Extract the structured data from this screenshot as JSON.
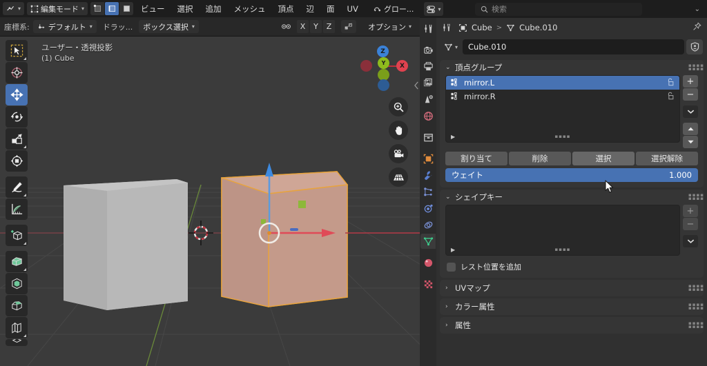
{
  "viewport_header": {
    "editor_type_icon": "editor-type-icon",
    "mode": "編集モード",
    "select_modes": [
      "vertex-select-icon",
      "edge-select-icon",
      "face-select-icon"
    ],
    "active_select_mode_index": 1,
    "menus": [
      "ビュー",
      "選択",
      "追加",
      "メッシュ",
      "頂点",
      "辺",
      "面",
      "UV"
    ],
    "orientation_icon": "global-orientation-icon",
    "orientation": "グロー...",
    "row2": {
      "transform_label": "座標系:",
      "transform_value": "デフォルト",
      "snap_label": "ドラッ...",
      "select_mode": "ボックス選択",
      "proportional_icon": "proportional-editing-icon",
      "axis_toggles": [
        "X",
        "Y",
        "Z"
      ],
      "mirror_icon": "mirror-icon",
      "options": "オプション"
    }
  },
  "viewport": {
    "overlay_line1": "ユーザー・透視投影",
    "overlay_line2": "(1) Cube",
    "gizmo_axes": [
      {
        "label": "Z",
        "color": "#3b82d8"
      },
      {
        "label": "Y",
        "color": "#8ebb1d"
      },
      {
        "label": "X",
        "color": "#e0424f"
      }
    ],
    "nav_buttons": [
      "zoom-icon",
      "pan-hand-icon",
      "camera-icon",
      "orthographic-grid-icon"
    ],
    "toolbar_items": [
      "tweak-select-box-icon",
      "cursor-icon",
      "move-icon",
      "rotate-icon",
      "scale-icon",
      "transform-icon",
      "annotate-icon",
      "measure-icon",
      "add-cube-icon",
      "extrude-region-icon",
      "inset-faces-icon",
      "bevel-icon",
      "loop-cut-icon",
      "knife-icon"
    ],
    "active_tool_index": 2,
    "objects": [
      {
        "name": "cube-unselected",
        "selected": false
      },
      {
        "name": "cube-selected",
        "selected": true
      }
    ],
    "collapse_arrow": "sidebar-collapse-arrow-icon"
  },
  "properties": {
    "header": {
      "editor_type_icon": "properties-editor-icon",
      "search_placeholder": "検索",
      "dropdown_icon": "chevron-down-icon"
    },
    "tabs": [
      {
        "name": "tool",
        "icon": "tool-icon",
        "color": "#b8b8b8",
        "selected": false
      },
      {
        "name": "render",
        "icon": "render-camera-icon",
        "color": "#c8c8c8",
        "selected": false
      },
      {
        "name": "output",
        "icon": "output-printer-icon",
        "color": "#c8c8c8",
        "selected": false
      },
      {
        "name": "view-layer",
        "icon": "view-layer-images-icon",
        "color": "#c8c8c8",
        "selected": false
      },
      {
        "name": "scene",
        "icon": "scene-cone-icon",
        "color": "#c8c8c8",
        "selected": false
      },
      {
        "name": "world",
        "icon": "world-globe-icon",
        "color": "#d06a7a",
        "selected": false
      },
      {
        "name": "collection",
        "icon": "collection-box-icon",
        "color": "#c8c8c8",
        "selected": false
      },
      {
        "name": "object",
        "icon": "object-square-icon",
        "color": "#e08b3c",
        "selected": false
      },
      {
        "name": "modifiers",
        "icon": "wrench-icon",
        "color": "#5a7fd0",
        "selected": false
      },
      {
        "name": "particles",
        "icon": "particles-icon",
        "color": "#7b92d8",
        "selected": false
      },
      {
        "name": "physics",
        "icon": "physics-orbit-icon",
        "color": "#6f8ddb",
        "selected": false
      },
      {
        "name": "constraints",
        "icon": "constraints-icon",
        "color": "#7b92d8",
        "selected": false
      },
      {
        "name": "object-data",
        "icon": "mesh-data-triangle-icon",
        "color": "#3ec98b",
        "selected": true
      },
      {
        "name": "material",
        "icon": "material-sphere-icon",
        "color": "#d4566a",
        "selected": false
      },
      {
        "name": "texture",
        "icon": "texture-checker-icon",
        "color": "#d4566a",
        "selected": false
      }
    ],
    "breadcrumb": {
      "tool_icon": "properties-tool-icon",
      "items": [
        "Cube",
        "Cube.010"
      ],
      "separator": ">",
      "object_icon": "object-square-icon",
      "data_icon": "mesh-data-triangle-icon",
      "pin_icon": "pin-icon"
    },
    "id_block": {
      "icon": "mesh-data-triangle-icon",
      "name": "Cube.010",
      "shield_icon": "fake-user-shield-icon"
    },
    "panels": [
      {
        "id": "vertex_groups",
        "title": "頂点グループ",
        "expanded": true,
        "list": [
          {
            "label": "mirror.L",
            "selected": true,
            "lock_icon": "unlocked-icon"
          },
          {
            "label": "mirror.R",
            "selected": false,
            "lock_icon": "unlocked-icon"
          }
        ],
        "side_buttons": [
          "+",
          "−",
          "chevron-down-icon",
          "move-up-icon",
          "move-down-icon"
        ],
        "buttons": [
          {
            "label": "割り当て",
            "hover": false
          },
          {
            "label": "削除",
            "hover": false
          },
          {
            "label": "選択",
            "hover": true
          },
          {
            "label": "選択解除",
            "hover": false
          }
        ],
        "weight": {
          "label": "ウェイト",
          "value": "1.000",
          "color": "#4772b3"
        }
      },
      {
        "id": "shape_keys",
        "title": "シェイプキー",
        "expanded": true,
        "list": [],
        "side_buttons": [
          "+",
          "−",
          "chevron-down-icon"
        ],
        "checkbox": {
          "label": "レスト位置を追加",
          "checked": false
        }
      },
      {
        "id": "uv_maps",
        "title": "UVマップ",
        "expanded": false
      },
      {
        "id": "color_attributes",
        "title": "カラー属性",
        "expanded": false
      },
      {
        "id": "attributes",
        "title": "属性",
        "expanded": false
      }
    ]
  },
  "colors": {
    "accent_blue": "#4772b3",
    "header_bg": "#1d1d1d",
    "panel_bg": "#353535",
    "props_bg": "#303030",
    "viewport_bg": "#3b3b3b",
    "selected_object_outline": "#e8a33d"
  }
}
